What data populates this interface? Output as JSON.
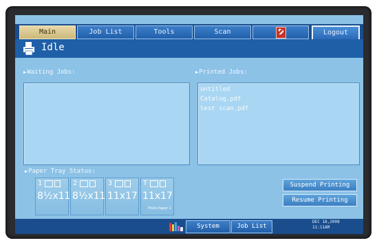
{
  "tabs": {
    "main": "Main",
    "job_list": "Job List",
    "tools": "Tools",
    "scan": "Scan",
    "logout": "Logout"
  },
  "status": {
    "text": "Idle"
  },
  "waiting": {
    "label": "Waiting Jobs:",
    "items": []
  },
  "printed": {
    "label": "Printed Jobs:",
    "items": [
      "untitled",
      "Catalog.pdf",
      "test scan.pdf"
    ]
  },
  "paper_tray": {
    "label": "Paper Tray Status:",
    "trays": [
      {
        "id": "1",
        "size": "8½x11",
        "note": ""
      },
      {
        "id": "2",
        "size": "8½x11",
        "note": ""
      },
      {
        "id": "3",
        "size": "11x17",
        "note": ""
      },
      {
        "id": "T",
        "size": "11x17",
        "note": "Thick Paper 1"
      }
    ]
  },
  "buttons": {
    "suspend": "Suspend Printing",
    "resume": "Resume Printing"
  },
  "bottom": {
    "system_status": "System Status",
    "job_list": "Job List"
  },
  "clock": {
    "date": "DEC 18,2008",
    "time": "11:11AM"
  },
  "colors": {
    "screen": "#8cc2e6",
    "bar": "#1e5fa8",
    "accent_tab": "#e8d9a8",
    "card_icon": "#c83428"
  },
  "icons": [
    "printer-icon",
    "card-icon",
    "tray-status-icon"
  ]
}
